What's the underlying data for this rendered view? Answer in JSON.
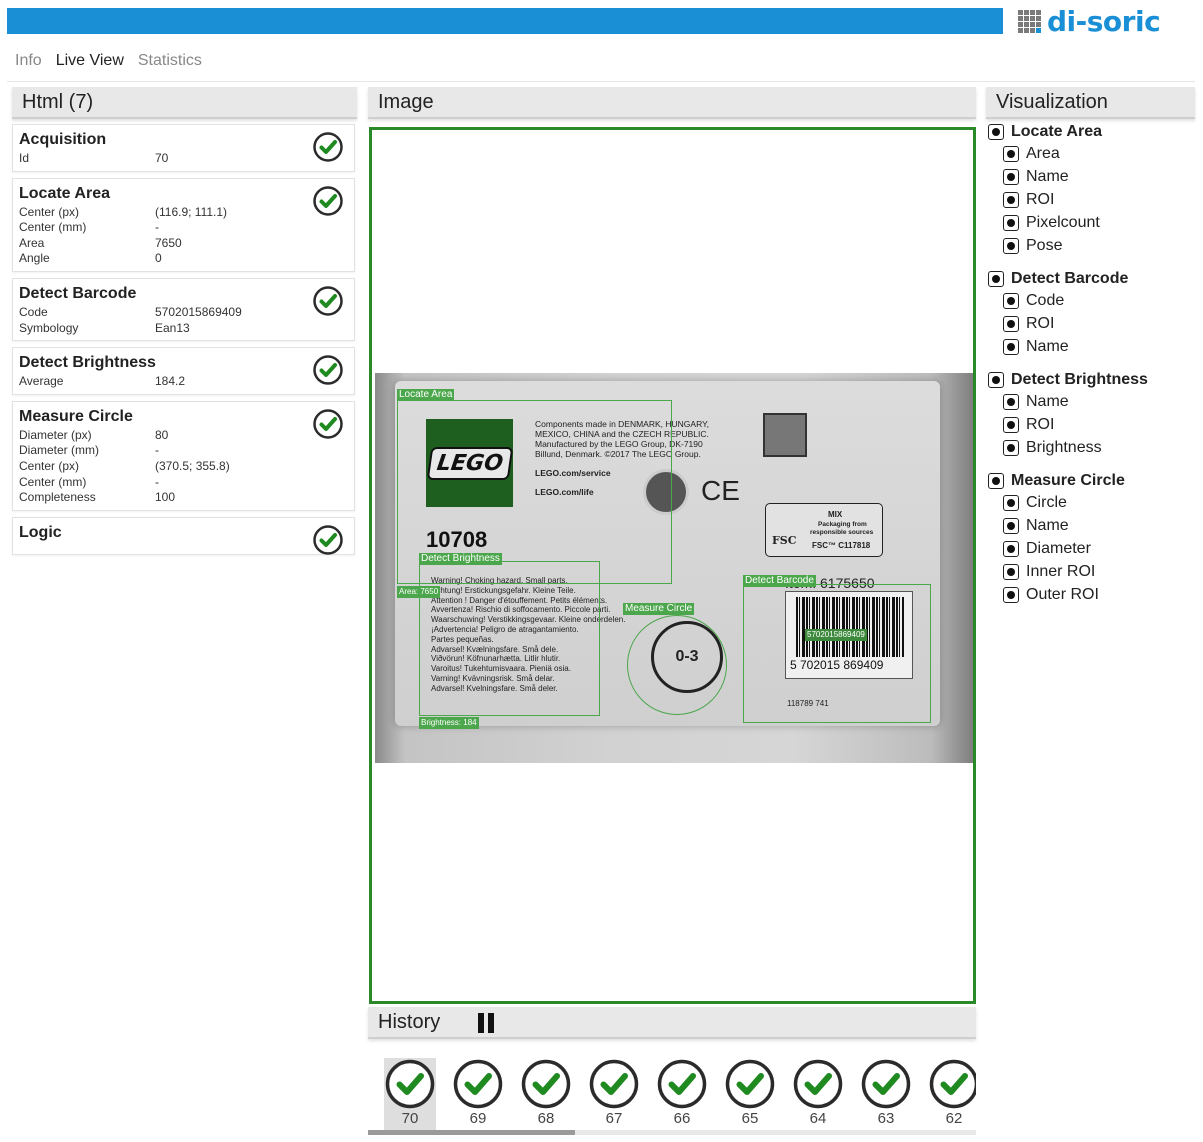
{
  "brand": {
    "name": "di-soric"
  },
  "nav": {
    "tabs": [
      "Info",
      "Live View",
      "Statistics"
    ],
    "active": "Live View"
  },
  "left": {
    "title": "Html (7)",
    "steps": [
      {
        "title": "Acquisition",
        "status": "ok",
        "rows": [
          [
            "Id",
            "70"
          ]
        ]
      },
      {
        "title": "Locate Area",
        "status": "ok",
        "rows": [
          [
            "Center (px)",
            "(116.9; 111.1)"
          ],
          [
            "Center (mm)",
            "-"
          ],
          [
            "Area",
            "7650"
          ],
          [
            "Angle",
            "0"
          ]
        ]
      },
      {
        "title": "Detect Barcode",
        "status": "ok",
        "rows": [
          [
            "Code",
            "5702015869409"
          ],
          [
            "Symbology",
            "Ean13"
          ]
        ]
      },
      {
        "title": "Detect Brightness",
        "status": "ok",
        "rows": [
          [
            "Average",
            "184.2"
          ]
        ]
      },
      {
        "title": "Measure Circle",
        "status": "ok",
        "rows": [
          [
            "Diameter (px)",
            "80"
          ],
          [
            "Diameter (mm)",
            "-"
          ],
          [
            "Center (px)",
            "(370.5; 355.8)"
          ],
          [
            "Center (mm)",
            "-"
          ],
          [
            "Completeness",
            "100"
          ]
        ]
      },
      {
        "title": "Logic",
        "status": "ok",
        "rows": []
      }
    ]
  },
  "image": {
    "title": "Image",
    "status": "ok",
    "box": {
      "brand": "LEGO",
      "set_number": "10708",
      "info_lines": [
        "Components made in DENMARK, HUNGARY,",
        "MEXICO, CHINA and the CZECH REPUBLIC.",
        "Manufactured by the LEGO Group, DK-7190",
        "Billund, Denmark. ©2017 The LEGO Group."
      ],
      "urls": [
        "LEGO.com/service",
        "LEGO.com/life"
      ],
      "ce": "CE",
      "fsc": {
        "title": "MIX",
        "line1": "Packaging from",
        "line2": "responsible sources",
        "code": "FSC™ C117818",
        "mark": "FSC"
      },
      "item": "Item: 6175650",
      "barcode_text": "5  702015  869409",
      "barcode_sub": "118789 741",
      "age": "0-3",
      "warnings": [
        "Warning! Choking hazard. Small parts.",
        "Achtung! Erstickungsgefahr. Kleine Teile.",
        "Attention ! Danger d'étouffement. Petits éléments.",
        "Avvertenza! Rischio di soffocamento. Piccole parti.",
        "Waarschuwing! Verstikkingsgevaar. Kleine onderdelen.",
        "¡Advertencia! Peligro de atragantamiento.",
        " Partes pequeñas.",
        "Advarsel! Kvælningsfare. Små dele.",
        "Viðvörun! Köfnunarhætta. Litlir hlutir.",
        "Varoitus! Tukehtumisvaara. Pieniä osia.",
        "Varning! Kvävningsrisk. Små delar.",
        "Advarsel! Kvelningsfare. Små deler."
      ]
    },
    "overlays": {
      "locate_area": "Locate Area",
      "area_label": "Area: 7650",
      "detect_brightness": "Detect Brightness",
      "brightness_label": "Brightness: 184",
      "measure_circle": "Measure Circle",
      "detect_barcode": "Detect Barcode",
      "barcode_value": "5702015869409"
    }
  },
  "history": {
    "title": "History",
    "items": [
      "70",
      "69",
      "68",
      "67",
      "66",
      "65",
      "64",
      "63",
      "62"
    ],
    "selected": "70",
    "scroll_fraction": 0.34
  },
  "visualization": {
    "title": "Visualization",
    "groups": [
      {
        "name": "Locate Area",
        "items": [
          "Area",
          "Name",
          "ROI",
          "Pixelcount",
          "Pose"
        ]
      },
      {
        "name": "Detect Barcode",
        "items": [
          "Code",
          "ROI",
          "Name"
        ]
      },
      {
        "name": "Detect Brightness",
        "items": [
          "Name",
          "ROI",
          "Brightness"
        ]
      },
      {
        "name": "Measure Circle",
        "items": [
          "Circle",
          "Name",
          "Diameter",
          "Inner ROI",
          "Outer ROI"
        ]
      }
    ]
  },
  "colors": {
    "accent": "#1a8fd6",
    "ok": "#2a8a2a",
    "overlay": "#4ca64c"
  },
  "icons": {
    "ok": "check-circle-icon",
    "pause": "pause-icon",
    "radio": "checked-radio-icon",
    "logo": "di-soric-logo"
  }
}
